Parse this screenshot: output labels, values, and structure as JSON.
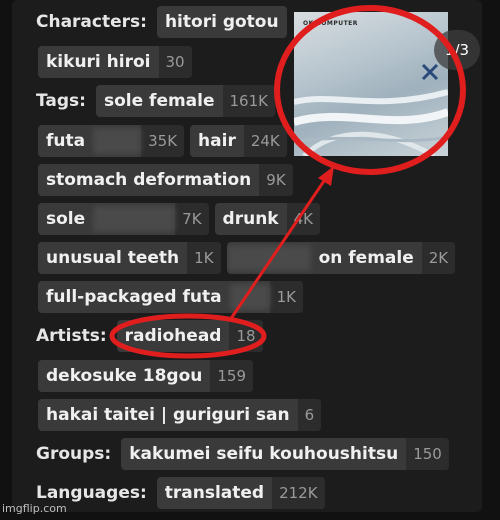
{
  "sections": {
    "characters": {
      "label": "Characters:",
      "tags": [
        {
          "name": "hitori gotou",
          "count": ""
        },
        {
          "name": "kikuri hiroi",
          "count": "30"
        }
      ]
    },
    "tags": {
      "label": "Tags:",
      "tags": [
        {
          "name": "sole female",
          "count": "161K"
        },
        {
          "name": "futa",
          "count": "35K"
        },
        {
          "name": "hair",
          "count": "24K"
        },
        {
          "name": "stomach deformation",
          "count": "9K"
        },
        {
          "name": "sole",
          "count": "7K"
        },
        {
          "name": "drunk",
          "count": "4K"
        },
        {
          "name": "unusual teeth",
          "count": "1K"
        },
        {
          "name": "on female",
          "count": "2K"
        },
        {
          "name": "full-packaged futa",
          "count": "1K"
        }
      ]
    },
    "artists": {
      "label": "Artists:",
      "tags": [
        {
          "name": "radiohead",
          "count": "18"
        },
        {
          "name": "dekosuke 18gou",
          "count": "159"
        },
        {
          "name": "hakai taitei | guriguri san",
          "count": "6"
        }
      ]
    },
    "groups": {
      "label": "Groups:",
      "tags": [
        {
          "name": "kakumei seifu kouhoushitsu",
          "count": "150"
        }
      ]
    },
    "languages": {
      "label": "Languages:",
      "tags": [
        {
          "name": "translated",
          "count": "212K"
        }
      ]
    }
  },
  "album": {
    "title": "OK COMPUTER",
    "icon": "album-cover-image"
  },
  "image_counter": "1/3",
  "watermark": "imgflip.com",
  "colors": {
    "highlight": "#e01e1e",
    "chip": "#3a3a3a",
    "background": "#1c1c1c"
  }
}
